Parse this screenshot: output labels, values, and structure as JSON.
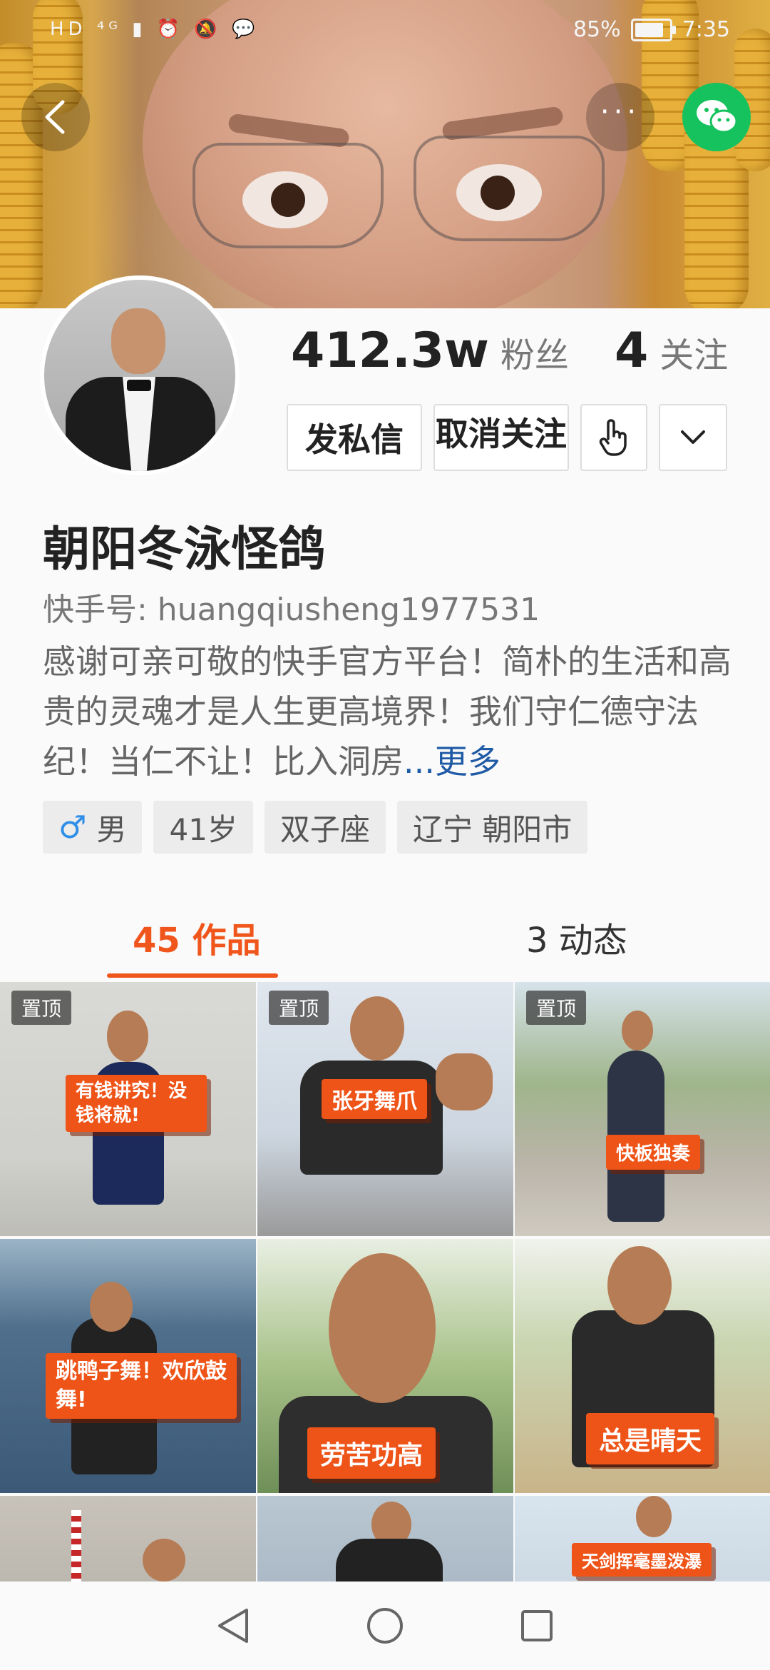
{
  "status_bar": {
    "left_icons": "HD ⁴ᴳ ▮ ⏰ 🔕 💬",
    "battery": "85%",
    "battery_level": 0.85,
    "time": "7:35"
  },
  "header": {
    "more_label": "···"
  },
  "profile": {
    "followers_count": "412.3w",
    "followers_label": "粉丝",
    "following_count": "4",
    "following_label": "关注",
    "name": "朝阳冬泳怪鸽",
    "user_id": "快手号: huangqiusheng1977531",
    "bio_text": "感谢可亲可敬的快手官方平台！简朴的生活和高贵的灵魂才是人生更高境界！我们守仁德守法纪！当仁不让！比入洞房",
    "bio_ellipsis": "...",
    "bio_more": "更多",
    "tags": [
      "男",
      "41岁",
      "双子座",
      "辽宁 朝阳市"
    ]
  },
  "actions": {
    "message_label": "发私信",
    "unfollow_label": "取消关注"
  },
  "tabs": {
    "works_label": "45 作品",
    "moments_label": "3 动态"
  },
  "grid": {
    "pinned_label": "置顶",
    "captions": [
      "有钱讲究！没钱将就!",
      "张牙舞爪",
      "快板独奏",
      "跳鸭子舞！欢欣鼓舞!",
      "劳苦功高",
      "总是晴天",
      "",
      "",
      "天剑挥毫墨泼瀑"
    ]
  },
  "colors": {
    "accent": "#f0561c",
    "caption_bg": "#ee5317",
    "wechat": "#15c25e",
    "link": "#1f5aa6"
  },
  "icons": [
    "back-arrow-icon",
    "more-dots-icon",
    "wechat-icon",
    "hand-pointer-icon",
    "chevron-down-icon",
    "male-icon",
    "nav-back-icon",
    "nav-home-icon",
    "nav-recents-icon"
  ]
}
